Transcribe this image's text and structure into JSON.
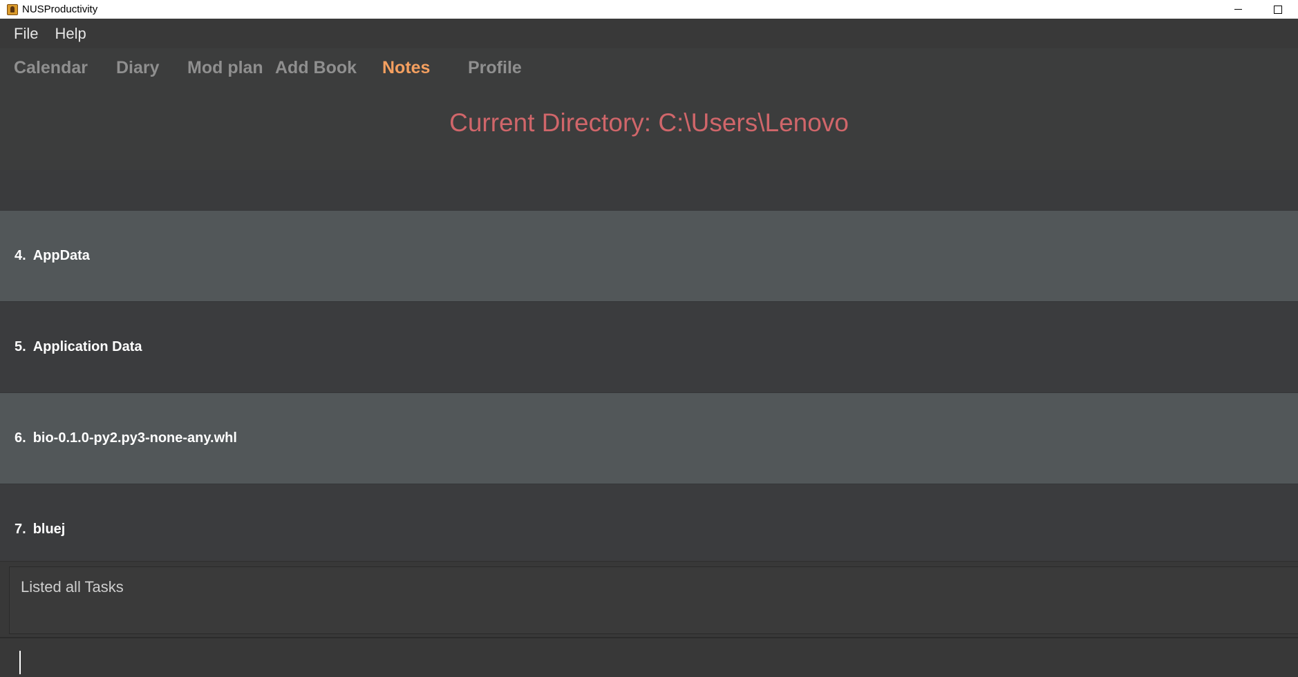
{
  "window": {
    "title": "NUSProductivity",
    "icon": "app-icon",
    "controls": {
      "minimize_icon": "minimize-icon",
      "maximize_icon": "maximize-icon"
    }
  },
  "menu": {
    "file_label": "File",
    "help_label": "Help"
  },
  "tabs": [
    {
      "label": "Calendar",
      "active": false
    },
    {
      "label": "Diary",
      "active": false
    },
    {
      "label": "Mod plan",
      "active": false
    },
    {
      "label": "Add Book",
      "active": false
    },
    {
      "label": "Notes",
      "active": true
    },
    {
      "label": "Profile",
      "active": false
    }
  ],
  "directory": {
    "text": "Current Directory: C:\\Users\\Lenovo"
  },
  "files": [
    {
      "index": "4.",
      "name": "AppData"
    },
    {
      "index": "5.",
      "name": "Application Data"
    },
    {
      "index": "6.",
      "name": "bio-0.1.0-py2.py3-none-any.whl"
    },
    {
      "index": "7.",
      "name": "bluej"
    }
  ],
  "result": {
    "text": "Listed all Tasks"
  },
  "command": {
    "value": "",
    "placeholder": ""
  },
  "colors": {
    "accent_tab": "#f5a060",
    "directory_text": "#d0666a",
    "row_alt": "#525759",
    "row_base": "#3b3c3e",
    "background": "#383838"
  }
}
